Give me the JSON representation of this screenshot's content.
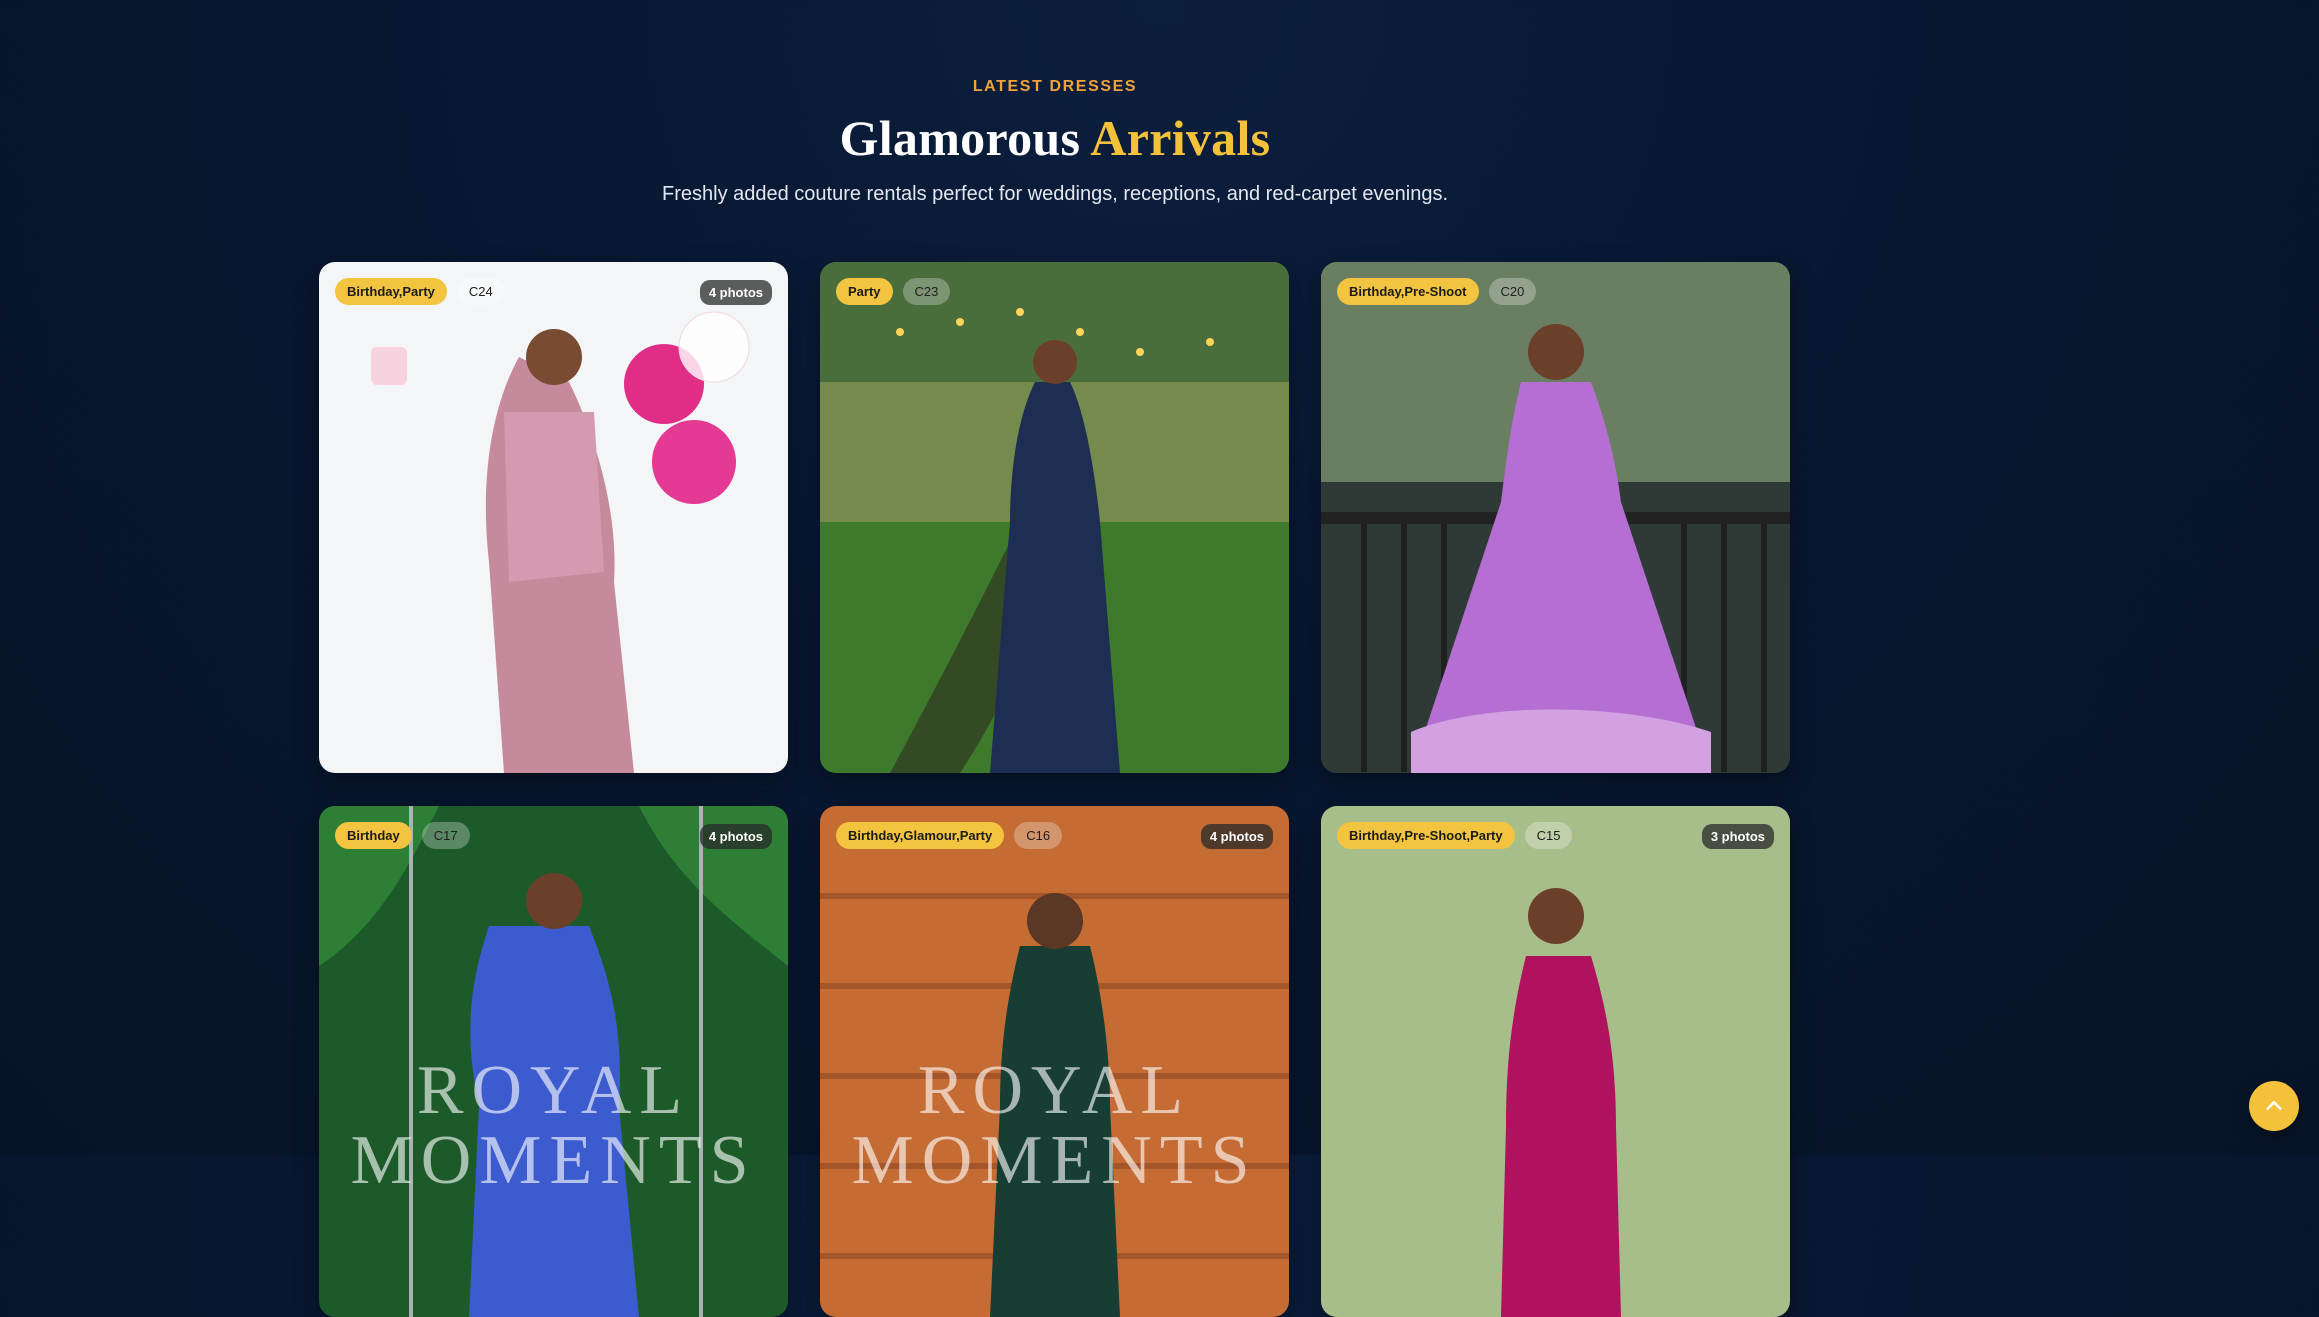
{
  "header": {
    "eyebrow": "LATEST DRESSES",
    "title_main": "Glamorous",
    "title_accent": "Arrivals",
    "subtitle": "Freshly added couture rentals perfect for weddings, receptions, and red-carpet evenings."
  },
  "cards": [
    {
      "category": "Birthday,Party",
      "code": "C24",
      "photos": "4 photos"
    },
    {
      "category": "Party",
      "code": "C23",
      "photos": ""
    },
    {
      "category": "Birthday,Pre-Shoot",
      "code": "C20",
      "photos": ""
    },
    {
      "category": "Birthday",
      "code": "C17",
      "photos": "4 photos",
      "watermark_1": "ROYAL",
      "watermark_2": "MOMENTS"
    },
    {
      "category": "Birthday,Glamour,Party",
      "code": "C16",
      "photos": "4 photos",
      "watermark_1": "ROYAL",
      "watermark_2": "MOMENTS"
    },
    {
      "category": "Birthday,Pre-Shoot,Party",
      "code": "C15",
      "photos": "3 photos"
    }
  ],
  "colors": {
    "background": "#081731",
    "accent_gold": "#f3c23a",
    "eyebrow_orange": "#f2a33a",
    "tag_yellow": "#f3c43f"
  },
  "icons": {
    "scroll_top": "chevron-up-icon"
  }
}
